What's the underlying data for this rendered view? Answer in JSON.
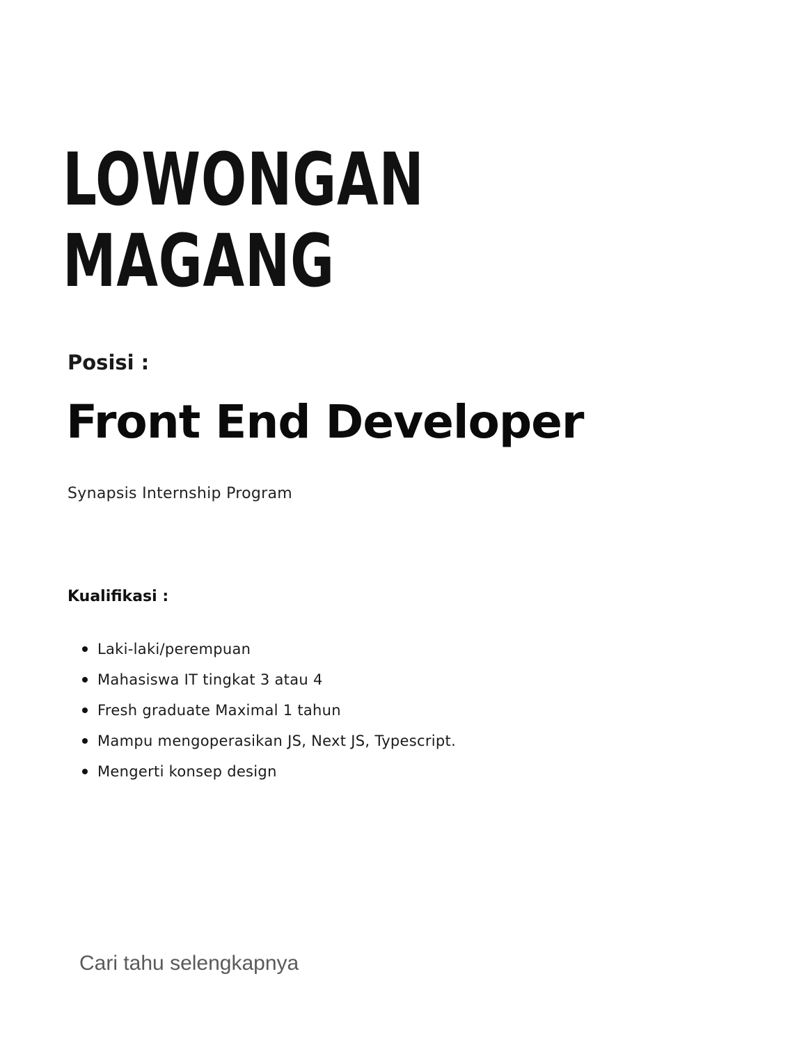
{
  "headline": {
    "line1": "LOWONGAN",
    "line2": "MAGANG"
  },
  "position": {
    "label": "Posisi :",
    "title": "Front End Developer"
  },
  "program": "Synapsis Internship Program",
  "qualifications": {
    "label": "Kualifikasi :",
    "items": [
      "Laki-laki/perempuan",
      "Mahasiswa IT tingkat 3 atau 4",
      "Fresh graduate Maximal 1 tahun",
      "Mampu mengoperasikan JS, Next JS, Typescript.",
      "Mengerti konsep design"
    ]
  },
  "footer": {
    "link_label": "Cari tahu selengkapnya"
  }
}
